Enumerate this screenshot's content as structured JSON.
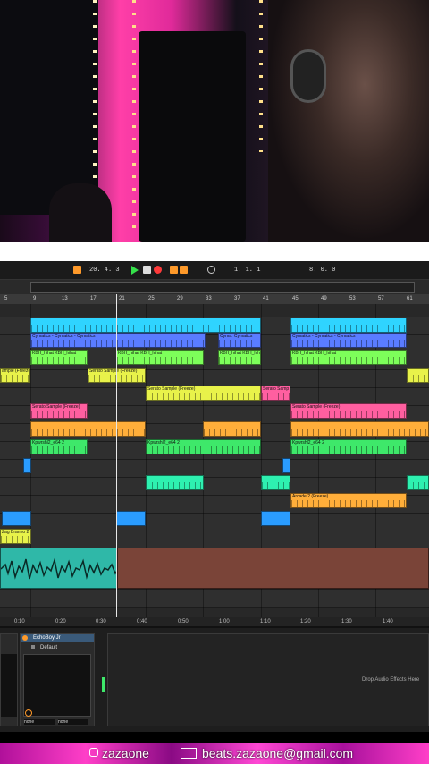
{
  "transport": {
    "tempo": "20.  4.  3",
    "position": "1.  1.  1",
    "loop_length": "8.  0.  0"
  },
  "ruler": {
    "bars": [
      "5",
      "9",
      "13",
      "17",
      "21",
      "25",
      "29",
      "33",
      "37",
      "41",
      "45",
      "49",
      "53",
      "57",
      "61"
    ]
  },
  "timeline": {
    "times": [
      "0:10",
      "0:20",
      "0:30",
      "0:40",
      "0:50",
      "1:00",
      "1:10",
      "1:20",
      "1:30",
      "1:40"
    ]
  },
  "clips": {
    "cymatics": "Cymatics - Cymatics - Cymatics",
    "cymatics_short": "Cyma: Cymatics",
    "kbh_hihat": "KBH_hihat  KBH_hihat",
    "kbh_hihat_short": "KBH_hihat",
    "serato_sample": "Serato Sample (Freeze)",
    "serato_sample_short": "Serato Samp",
    "ample_freeze": "ample (Freeze)",
    "kpwrshl": "Kpwrshl2_e64 2",
    "arcade": "Arcade 2 (Freeze)",
    "zag": "Zag Branno 2"
  },
  "devices": {
    "echo_title": "EchoBoy Jr",
    "preset": "Default",
    "select_left": "none",
    "select_right": "none",
    "drop_hint": "Drop Audio Effects Here"
  },
  "footer": {
    "handle": "zazaone",
    "email": "beats.zazaone@gmail.com"
  },
  "colors": {
    "cyan": "#2fd4ff",
    "blue": "#5a7cff",
    "green": "#7dff5a",
    "yellow": "#e8f24a",
    "pink": "#ff5fa0",
    "orange": "#ffae3a",
    "lime": "#3ee86a",
    "mint": "#2ef0b0",
    "sky": "#2a9cff",
    "audio": "#2fb8a8",
    "brown": "#7a4438",
    "accent": "#ff9a2a"
  }
}
